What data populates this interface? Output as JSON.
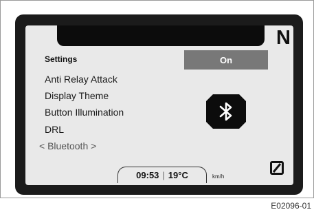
{
  "display": {
    "gear": "N",
    "menu_title": "Settings",
    "menu_items": [
      "Anti Relay Attack",
      "Display Theme",
      "Button Illumination",
      "DRL"
    ],
    "selected_item": "< Bluetooth >",
    "toggle_value": "On",
    "status": {
      "time": "09:53",
      "separator": "|",
      "temperature": "19°C"
    },
    "speed_unit": "km/h",
    "icons": {
      "bluetooth": "bluetooth-icon",
      "ring_toggle": "zero-slash-icon"
    }
  },
  "caption": "E02096-01"
}
